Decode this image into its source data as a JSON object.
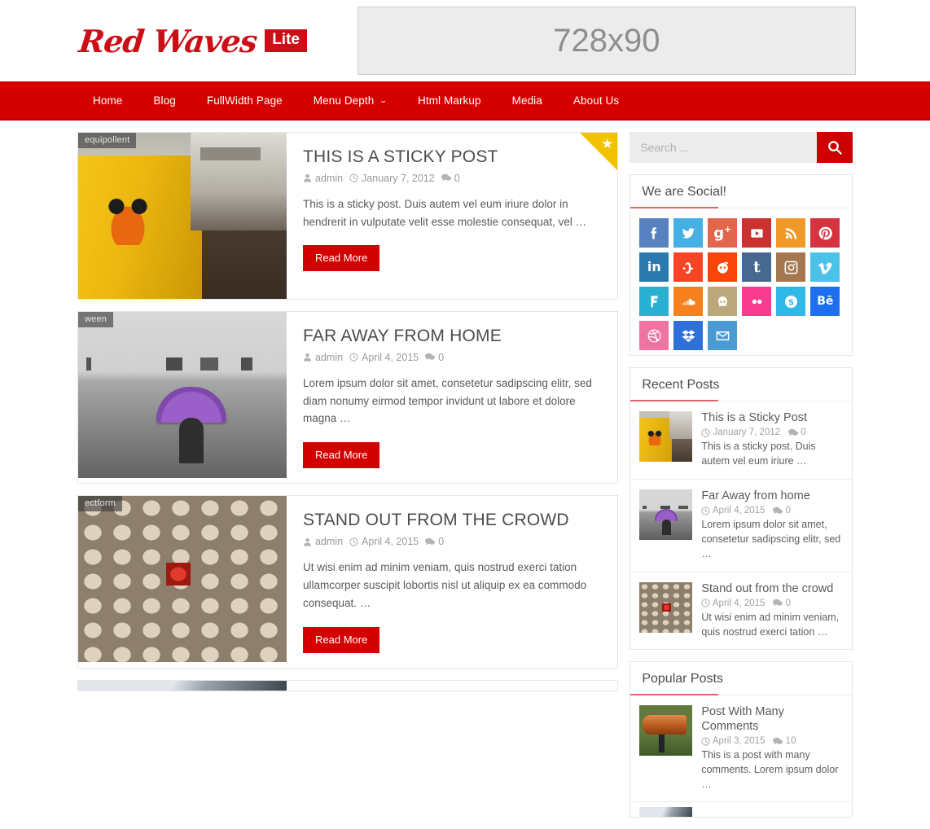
{
  "header": {
    "logo_text": "Red Waves",
    "logo_badge": "Lite",
    "ad_label": "728x90"
  },
  "nav": {
    "items": [
      {
        "label": "Home",
        "has_dropdown": false
      },
      {
        "label": "Blog",
        "has_dropdown": false
      },
      {
        "label": "FullWidth Page",
        "has_dropdown": false
      },
      {
        "label": "Menu Depth",
        "has_dropdown": true
      },
      {
        "label": "Html Markup",
        "has_dropdown": false
      },
      {
        "label": "Media",
        "has_dropdown": false
      },
      {
        "label": "About Us",
        "has_dropdown": false
      }
    ],
    "dropdown_glyph": "⌄"
  },
  "posts": [
    {
      "thumb_tag": "equipollent",
      "title": "THIS IS A STICKY POST",
      "author": "admin",
      "date": "January 7, 2012",
      "comments": "0",
      "excerpt": "This is a sticky post. Duis autem vel eum iriure dolor in hendrerit in vulputate velit esse molestie consequat, vel …",
      "read_more": "Read More",
      "sticky": true
    },
    {
      "thumb_tag": "ween",
      "title": "FAR AWAY FROM HOME",
      "author": "admin",
      "date": "April 4, 2015",
      "comments": "0",
      "excerpt": " Lorem ipsum dolor sit amet, consetetur sadipscing elitr, sed diam nonumy eirmod tempor invidunt ut labore et dolore magna …",
      "read_more": "Read More",
      "sticky": false
    },
    {
      "thumb_tag": "ectform",
      "title": "STAND OUT FROM THE CROWD",
      "author": "admin",
      "date": "April 4, 2015",
      "comments": "0",
      "excerpt": "Ut wisi enim ad minim veniam, quis nostrud exerci tation ullamcorper suscipit lobortis nisl ut aliquip ex ea commodo consequat. …",
      "read_more": "Read More",
      "sticky": false
    }
  ],
  "sidebar": {
    "search": {
      "placeholder": "Search ...",
      "value": "",
      "button_icon": "search-icon"
    },
    "social_widget": {
      "title": "We are Social!",
      "icons": [
        {
          "name": "facebook",
          "glyph": "f",
          "color": "#5881c1"
        },
        {
          "name": "twitter",
          "glyph": "t",
          "color": "#45b0e3"
        },
        {
          "name": "google-plus",
          "glyph": "g+",
          "color": "#e1664c"
        },
        {
          "name": "youtube",
          "glyph": "yt",
          "color": "#c9322f"
        },
        {
          "name": "rss",
          "glyph": "rss",
          "color": "#ef9a28"
        },
        {
          "name": "pinterest",
          "glyph": "p",
          "color": "#d5333f"
        },
        {
          "name": "linkedin",
          "glyph": "in",
          "color": "#2a7ab0"
        },
        {
          "name": "stumbleupon",
          "glyph": "su",
          "color": "#f74425"
        },
        {
          "name": "reddit",
          "glyph": "r",
          "color": "#fa4409"
        },
        {
          "name": "tumblr",
          "glyph": "t",
          "color": "#47688f"
        },
        {
          "name": "instagram",
          "glyph": "ig",
          "color": "#a4774e"
        },
        {
          "name": "vimeo",
          "glyph": "v",
          "color": "#4cc2e8"
        },
        {
          "name": "foursquare",
          "glyph": "4",
          "color": "#28b1d0"
        },
        {
          "name": "soundcloud",
          "glyph": "sc",
          "color": "#f8801d"
        },
        {
          "name": "github",
          "glyph": "gh",
          "color": "#bba97b"
        },
        {
          "name": "flickr",
          "glyph": "fl",
          "color": "#fa3b90"
        },
        {
          "name": "skype",
          "glyph": "s",
          "color": "#2fb9e8"
        },
        {
          "name": "behance",
          "glyph": "Bē",
          "color": "#1e6ff0"
        },
        {
          "name": "dribbble",
          "glyph": "d",
          "color": "#f074a2"
        },
        {
          "name": "dropbox",
          "glyph": "db",
          "color": "#2e6fd8"
        },
        {
          "name": "email",
          "glyph": "@",
          "color": "#4a9bd4"
        }
      ]
    },
    "recent_posts": {
      "title": "Recent Posts",
      "items": [
        {
          "title": "This is a Sticky Post",
          "date": "January 7, 2012",
          "comments": "0",
          "excerpt": "This is a sticky post. Duis autem vel eum iriure …",
          "thumb": "mug"
        },
        {
          "title": "Far Away from home",
          "date": "April 4, 2015",
          "comments": "0",
          "excerpt": " Lorem ipsum dolor sit amet, consetetur sadipscing elitr, sed …",
          "thumb": "sea"
        },
        {
          "title": "Stand out from the crowd",
          "date": "April 4, 2015",
          "comments": "0",
          "excerpt": "Ut wisi enim ad minim veniam, quis nostrud exerci tation …",
          "thumb": "eggs"
        }
      ]
    },
    "popular_posts": {
      "title": "Popular Posts",
      "items": [
        {
          "title": "Post With Many Comments",
          "date": "April 3, 2015",
          "comments": "10",
          "excerpt": "This is a post with many comments. Lorem ipsum dolor …",
          "thumb": "bottle"
        }
      ]
    }
  },
  "colors": {
    "brand_red": "#d40000",
    "nav_red": "#d40000",
    "button_red": "#d40000",
    "sticky_yellow": "#f2c200",
    "title_gray": "#4c4c4c",
    "meta_gray": "#9a9a9a"
  }
}
